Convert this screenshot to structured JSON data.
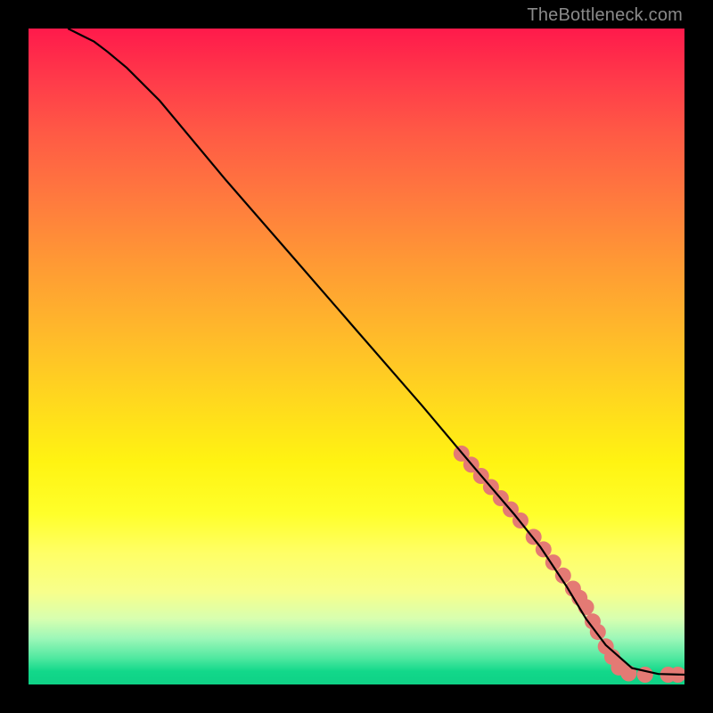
{
  "watermark": "TheBottleneck.com",
  "chart_data": {
    "type": "line",
    "title": "",
    "xlabel": "",
    "ylabel": "",
    "xlim": [
      0,
      100
    ],
    "ylim": [
      0,
      100
    ],
    "grid": false,
    "legend": false,
    "gradient_stops": [
      {
        "pos": 0,
        "color": "#ff1a4b"
      },
      {
        "pos": 8,
        "color": "#ff3b4a"
      },
      {
        "pos": 16,
        "color": "#ff5a45"
      },
      {
        "pos": 26,
        "color": "#ff7a3e"
      },
      {
        "pos": 36,
        "color": "#ff9a34"
      },
      {
        "pos": 46,
        "color": "#ffb82b"
      },
      {
        "pos": 56,
        "color": "#ffd61f"
      },
      {
        "pos": 66,
        "color": "#fff312"
      },
      {
        "pos": 74,
        "color": "#ffff2a"
      },
      {
        "pos": 80,
        "color": "#ffff66"
      },
      {
        "pos": 86,
        "color": "#f7ff8c"
      },
      {
        "pos": 90,
        "color": "#d7ffb0"
      },
      {
        "pos": 93,
        "color": "#9cf7b8"
      },
      {
        "pos": 96,
        "color": "#4fe8a0"
      },
      {
        "pos": 98,
        "color": "#12d88a"
      },
      {
        "pos": 100,
        "color": "#0fd186"
      }
    ],
    "series": [
      {
        "name": "curve",
        "type": "line",
        "color": "#000000",
        "x": [
          6,
          8,
          10,
          12,
          15,
          20,
          30,
          40,
          50,
          60,
          68,
          74,
          78,
          82,
          85,
          88,
          92,
          96,
          100
        ],
        "y": [
          100,
          99,
          98,
          96.5,
          94,
          89,
          77,
          65.5,
          54,
          42.5,
          33,
          26,
          21,
          15,
          10,
          6,
          2.5,
          1.6,
          1.5
        ]
      },
      {
        "name": "dots",
        "type": "scatter",
        "color": "#e47a74",
        "radius": 9,
        "x": [
          66,
          67.5,
          69,
          70.5,
          72,
          73.5,
          75,
          77,
          78.5,
          80,
          81.5,
          83,
          84,
          85,
          86,
          86.8,
          88,
          89,
          90,
          91.5,
          94,
          97.5,
          99
        ],
        "y": [
          35.2,
          33.5,
          31.8,
          30.1,
          28.4,
          26.7,
          25,
          22.5,
          20.6,
          18.6,
          16.6,
          14.6,
          13.2,
          11.8,
          9.6,
          8.0,
          5.8,
          4.2,
          2.6,
          1.7,
          1.5,
          1.5,
          1.5
        ]
      }
    ]
  }
}
